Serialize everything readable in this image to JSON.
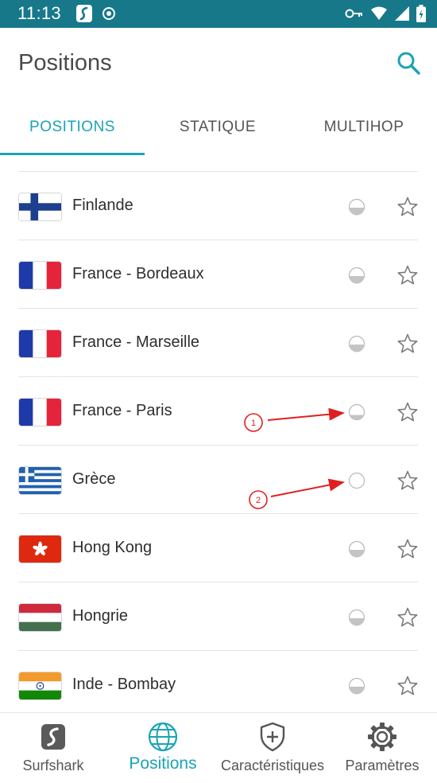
{
  "status_bar": {
    "time": "11:13",
    "left_icons": [
      "surfshark-notification-icon",
      "record-icon"
    ],
    "right_icons": [
      "vpn-key-icon",
      "wifi-icon",
      "signal-icon",
      "battery-icon"
    ]
  },
  "header": {
    "title": "Positions",
    "search_icon": "search-icon"
  },
  "tabs": [
    {
      "label": "POSITIONS",
      "active": true
    },
    {
      "label": "STATIQUE",
      "active": false
    },
    {
      "label": "MULTIHOP",
      "active": false
    }
  ],
  "locations": [
    {
      "name": "Finlande",
      "flag": "finland",
      "load_icon": "load-half-icon"
    },
    {
      "name": "France - Bordeaux",
      "flag": "france",
      "load_icon": "load-half-icon"
    },
    {
      "name": "France - Marseille",
      "flag": "france",
      "load_icon": "load-half-icon"
    },
    {
      "name": "France - Paris",
      "flag": "france",
      "load_icon": "load-low-icon"
    },
    {
      "name": "Grèce",
      "flag": "greece",
      "load_icon": "load-empty-icon"
    },
    {
      "name": "Hong Kong",
      "flag": "hongkong",
      "load_icon": "load-half-icon"
    },
    {
      "name": "Hongrie",
      "flag": "hungary",
      "load_icon": "load-half-icon"
    },
    {
      "name": "Inde - Bombay",
      "flag": "india",
      "load_icon": "load-half-icon"
    }
  ],
  "annotations": [
    {
      "number": "1"
    },
    {
      "number": "2"
    }
  ],
  "bottom_nav": [
    {
      "label": "Surfshark",
      "icon": "surfshark-logo-icon",
      "active": false
    },
    {
      "label": "Positions",
      "icon": "globe-icon",
      "active": true
    },
    {
      "label": "Caractéristiques",
      "icon": "shield-plus-icon",
      "active": false
    },
    {
      "label": "Paramètres",
      "icon": "gear-icon",
      "active": false
    }
  ],
  "colors": {
    "status_bar": "#17788a",
    "accent": "#1aa4b5",
    "annotation": "#e02020"
  }
}
